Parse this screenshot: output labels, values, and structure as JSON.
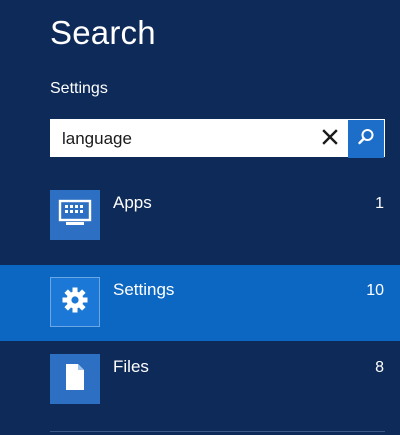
{
  "pane": {
    "title": "Search",
    "scope": "Settings"
  },
  "search": {
    "value": "language",
    "clear_icon": "close-icon",
    "go_icon": "search-icon"
  },
  "results": [
    {
      "label": "Apps",
      "count": "1",
      "icon": "apps-icon",
      "selected": false
    },
    {
      "label": "Settings",
      "count": "10",
      "icon": "gear-icon",
      "selected": true
    },
    {
      "label": "Files",
      "count": "8",
      "icon": "file-icon",
      "selected": false
    }
  ],
  "colors": {
    "background": "#0e2a58",
    "selected_row": "#0c67c2",
    "tile": "#2d6fc3",
    "search_button": "#1d6ec9"
  }
}
